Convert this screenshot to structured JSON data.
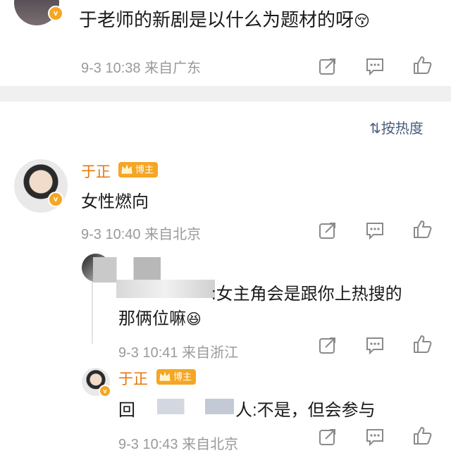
{
  "top_comment": {
    "text": "于老师的新剧是以什么为题材的呀",
    "emoji": "😚",
    "timestamp": "9-3 10:38",
    "location": "来自广东"
  },
  "sort": {
    "label": "按热度"
  },
  "reply1": {
    "author": "于正",
    "badge": "博主",
    "text": "女性燃向",
    "timestamp": "9-3 10:40",
    "location": "来自北京"
  },
  "reply2": {
    "text": ":女主角会是跟你上热搜的",
    "text_line2": "那俩位嘛",
    "emoji": "😆",
    "timestamp": "9-3 10:41",
    "location": "来自浙江"
  },
  "reply3": {
    "author": "于正",
    "badge": "博主",
    "prefix": "回",
    "suffix": "人:不是，但会参与",
    "timestamp": "9-3 10:43",
    "location": "来自北京"
  },
  "colors": {
    "name": "#e8760c",
    "meta": "#9a9a9a",
    "badge": "#f5a623",
    "divider": "#f0f0f0"
  },
  "icons": [
    "share-icon",
    "comment-icon",
    "like-icon",
    "verified-icon",
    "sort-icon",
    "crown-icon"
  ]
}
